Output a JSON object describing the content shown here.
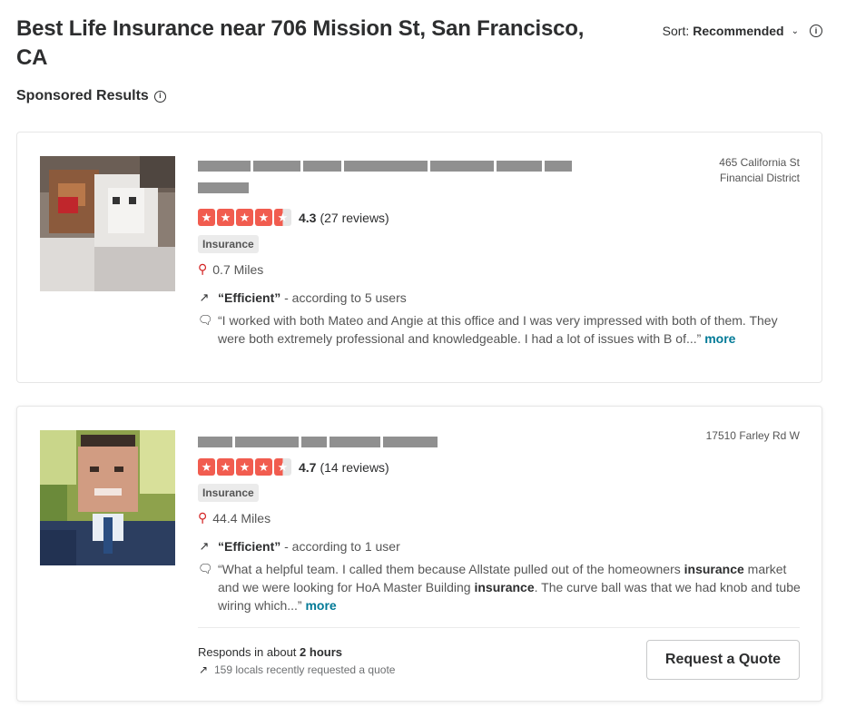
{
  "page": {
    "title": "Best Life Insurance near 706 Mission St, San Francisco, CA",
    "sort_label": "Sort:",
    "sort_value": "Recommended",
    "sponsored_label": "Sponsored Results"
  },
  "listings": [
    {
      "address_line1": "465 California St",
      "address_line2": "Financial District",
      "rating": "4.3",
      "reviews": "(27 reviews)",
      "category": "Insurance",
      "distance": "0.7 Miles",
      "highlight_quote": "“Efficient”",
      "highlight_suffix": " - according to 5 users",
      "snippet": "“I worked with both Mateo and Angie at this office and I was very impressed with both of them. They were both extremely professional and knowledgeable. I had a lot of issues with B of...”",
      "more": "more"
    },
    {
      "address_line1": "17510 Farley Rd W",
      "rating": "4.7",
      "reviews": "(14 reviews)",
      "category": "Insurance",
      "distance": "44.4 Miles",
      "highlight_quote": "“Efficient”",
      "highlight_suffix": " - according to 1 user",
      "snippet_parts": [
        "“What a helpful team. I called them because Allstate pulled out of the homeowners ",
        "insurance",
        " market and we were looking for HoA Master Building ",
        "insurance",
        ". The curve ball was that we had knob and tube wiring which...”"
      ],
      "more": "more",
      "responds_prefix": "Responds in about ",
      "responds_time": "2 hours",
      "locals_text": "159 locals recently requested a quote",
      "quote_button": "Request a Quote"
    }
  ],
  "colors": {
    "star": "#f15c4f",
    "link": "#027a97",
    "pin": "#d32323"
  },
  "icons": [
    "info-icon",
    "chevron-down-icon",
    "star-icon",
    "map-pin-icon",
    "trend-icon",
    "speech-bubble-icon"
  ]
}
